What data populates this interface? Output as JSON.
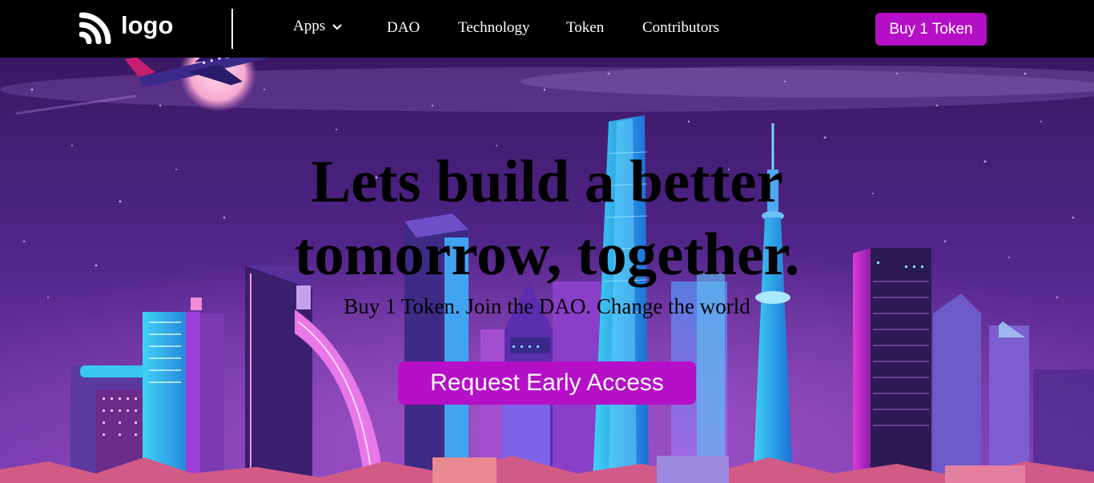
{
  "header": {
    "logo_text": "logo",
    "nav": {
      "apps": "Apps",
      "dao": "DAO",
      "technology": "Technology",
      "token": "Token",
      "contributors": "Contributors"
    },
    "buy_button": "Buy 1 Token"
  },
  "hero": {
    "headline_line1": "Lets build a better",
    "headline_line2": "tomorrow, together.",
    "subtitle": "Buy 1 Token. Join the DAO. Change the world",
    "cta": "Request Early Access",
    "background_image": "night-city-skyline-illustration"
  },
  "colors": {
    "accent": "#b50fc8",
    "navbar_bg": "#000000",
    "sky_top": "#3b1a63",
    "sky_bottom": "#6a2f9e"
  },
  "icons": {
    "logo": "rss-wave-logo-icon",
    "apps_dropdown": "chevron-down-icon"
  }
}
